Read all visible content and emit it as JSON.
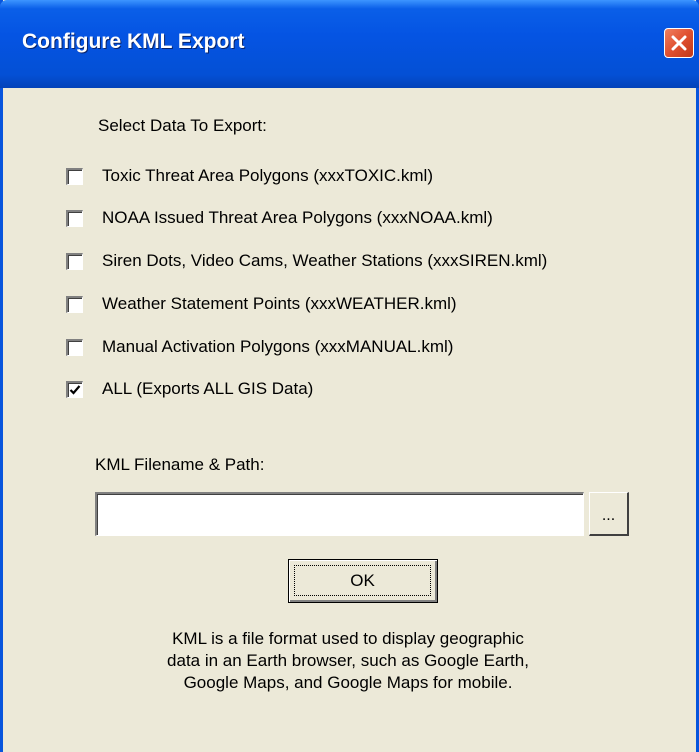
{
  "window": {
    "title": "Configure KML Export",
    "close_icon": "close-icon"
  },
  "select_label": "Select Data To Export:",
  "options": [
    {
      "label": "Toxic Threat Area Polygons  (xxxTOXIC.kml)",
      "checked": false
    },
    {
      "label": "NOAA Issued Threat Area Polygons  (xxxNOAA.kml)",
      "checked": false
    },
    {
      "label": "Siren Dots, Video Cams, Weather Stations  (xxxSIREN.kml)",
      "checked": false
    },
    {
      "label": "Weather Statement Points  (xxxWEATHER.kml)",
      "checked": false
    },
    {
      "label": "Manual Activation Polygons  (xxxMANUAL.kml)",
      "checked": false
    },
    {
      "label": "ALL  (Exports ALL GIS Data)",
      "checked": true
    }
  ],
  "filename": {
    "label": "KML Filename & Path:",
    "value": "",
    "browse_label": "..."
  },
  "ok_label": "OK",
  "info_lines": [
    "KML is a file format used to display geographic",
    "data in an Earth browser, such as Google Earth,",
    "Google Maps, and Google Maps for mobile."
  ],
  "colors": {
    "titlebar": "#0554e3",
    "window_bg": "#ece9d8",
    "close_button": "#e05030"
  }
}
